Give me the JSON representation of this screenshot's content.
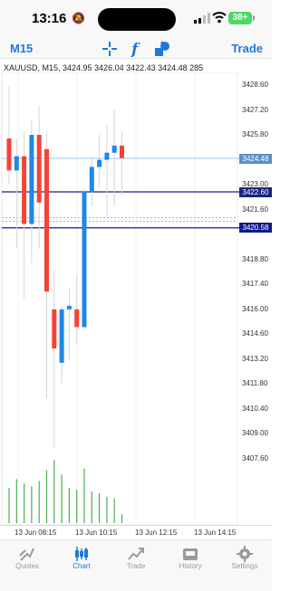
{
  "status_bar": {
    "time": "13:16",
    "battery": "38+"
  },
  "toolbar": {
    "timeframe": "M15",
    "trade_label": "Trade"
  },
  "chart": {
    "symbol_info": "XAUUSD, M15, 3424.95 3426.04 3422.43 3424.48 285",
    "price_scale": [
      "3428.60",
      "3427.20",
      "3425.80",
      "3423.00",
      "3421.60",
      "3418.80",
      "3417.40",
      "3416.00",
      "3414.60",
      "3413.20",
      "3411.80",
      "3410.40",
      "3409.00",
      "3407.60"
    ],
    "price_tags": {
      "bid": "3424.48",
      "high_line": "3422.60",
      "low_line": "3420.58"
    },
    "time_labels": [
      "13 Jun 08:15",
      "13 Jun 10:15",
      "13 Jun 12:15",
      "13 Jun 14:15"
    ],
    "colors": {
      "bull": "#1e88e5",
      "bear": "#f44336",
      "volume": "#4caf50"
    }
  },
  "chart_data": {
    "type": "candlestick",
    "ylim": [
      3406.5,
      3429.5
    ],
    "candles": [
      {
        "o": 3425.6,
        "h": 3428.6,
        "l": 3423.0,
        "c": 3423.8
      },
      {
        "o": 3423.8,
        "h": 3425.6,
        "l": 3419.4,
        "c": 3424.6
      },
      {
        "o": 3424.6,
        "h": 3426.0,
        "l": 3416.6,
        "c": 3420.8
      },
      {
        "o": 3420.8,
        "h": 3426.6,
        "l": 3418.6,
        "c": 3425.8
      },
      {
        "o": 3425.8,
        "h": 3427.4,
        "l": 3419.4,
        "c": 3422.0
      },
      {
        "o": 3425.0,
        "h": 3426.0,
        "l": 3411.0,
        "c": 3417.0
      },
      {
        "o": 3416.0,
        "h": 3418.2,
        "l": 3408.2,
        "c": 3413.8
      },
      {
        "o": 3413.0,
        "h": 3416.2,
        "l": 3411.8,
        "c": 3416.0
      },
      {
        "o": 3416.0,
        "h": 3417.2,
        "l": 3413.2,
        "c": 3416.2
      },
      {
        "o": 3416.0,
        "h": 3418.0,
        "l": 3414.0,
        "c": 3415.0
      },
      {
        "o": 3415.0,
        "h": 3422.8,
        "l": 3414.8,
        "c": 3422.6
      },
      {
        "o": 3422.6,
        "h": 3424.6,
        "l": 3421.8,
        "c": 3424.0
      },
      {
        "o": 3424.0,
        "h": 3425.8,
        "l": 3422.8,
        "c": 3424.4
      },
      {
        "o": 3424.4,
        "h": 3426.4,
        "l": 3421.2,
        "c": 3424.8
      },
      {
        "o": 3424.8,
        "h": 3427.2,
        "l": 3421.8,
        "c": 3425.2
      },
      {
        "o": 3425.2,
        "h": 3426.0,
        "l": 3422.4,
        "c": 3424.5
      }
    ],
    "volumes": [
      40,
      50,
      45,
      42,
      48,
      60,
      72,
      55,
      40,
      38,
      62,
      36,
      34,
      30,
      28,
      10
    ]
  },
  "tabs": [
    {
      "label": "Quotes",
      "icon": "quotes-icon"
    },
    {
      "label": "Chart",
      "icon": "chart-icon",
      "active": true
    },
    {
      "label": "Trade",
      "icon": "trade-icon"
    },
    {
      "label": "History",
      "icon": "history-icon"
    },
    {
      "label": "Settings",
      "icon": "settings-icon"
    }
  ]
}
